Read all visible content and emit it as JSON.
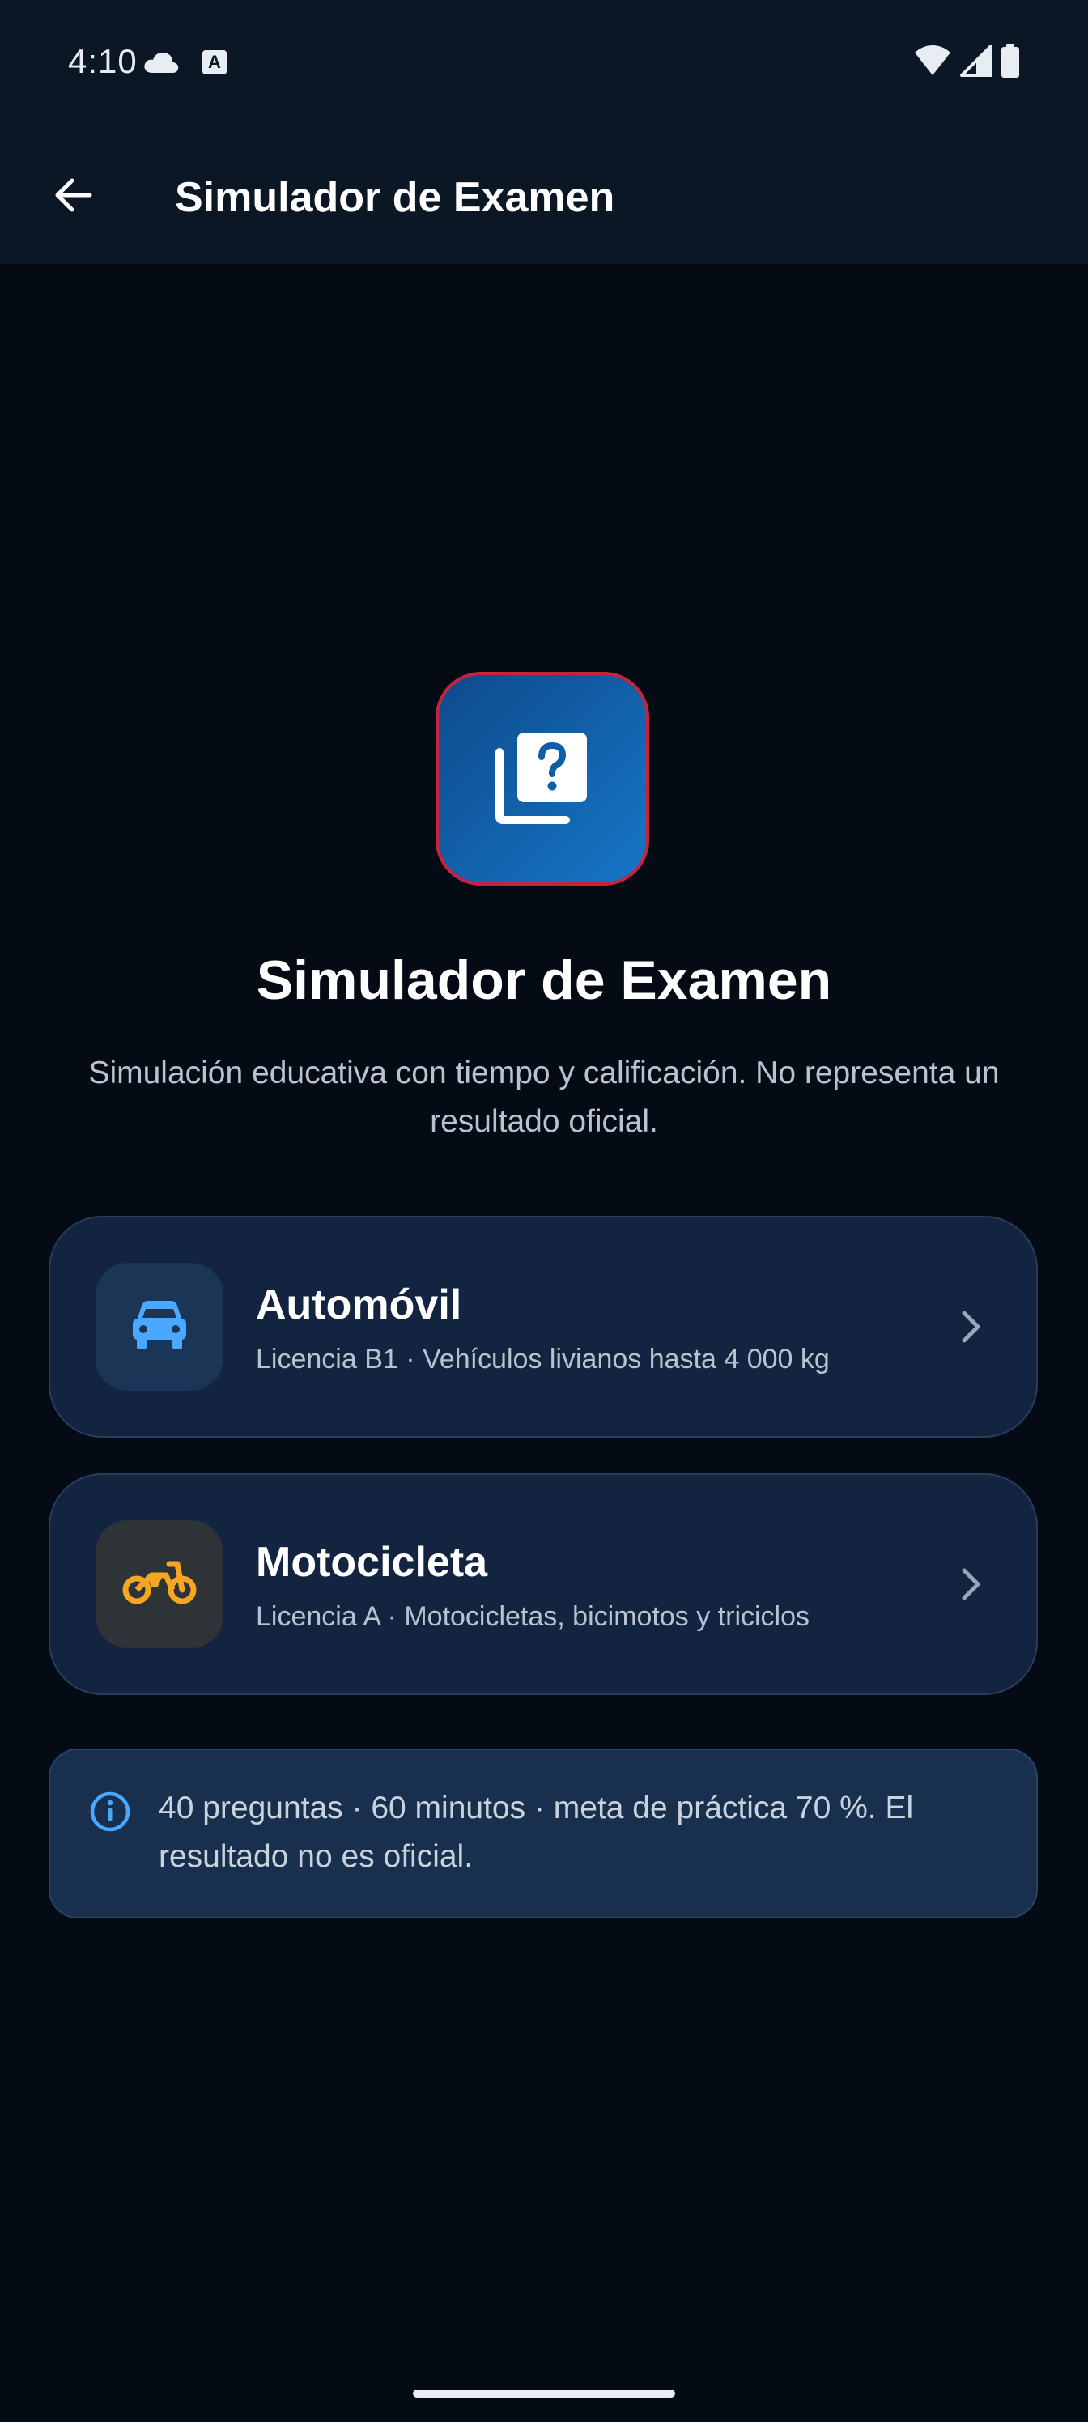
{
  "status_bar": {
    "time": "4:10",
    "icons": [
      "cloud-icon",
      "font-a-icon",
      "wifi-icon",
      "signal-icon",
      "battery-icon"
    ]
  },
  "app_bar": {
    "back_icon": "arrow-back-icon",
    "title": "Simulador de Examen"
  },
  "hero": {
    "icon": "quiz-icon",
    "title": "Simulador de Examen",
    "subtitle": "Simulación educativa con tiempo y calificación. No representa un resultado oficial."
  },
  "options": [
    {
      "icon": "car-icon",
      "title": "Automóvil",
      "description": "Licencia B1 · Vehículos livianos hasta 4 000 kg",
      "accent": "#4aa8ff"
    },
    {
      "icon": "motorcycle-icon",
      "title": "Motocicleta",
      "description": "Licencia A · Motocicletas, bicimotos y triciclos",
      "accent": "#f5a623"
    }
  ],
  "info": {
    "icon": "info-icon",
    "text": "40 preguntas · 60 minutos · meta de práctica 70 %. El resultado no es oficial."
  },
  "colors": {
    "background": "#050b14",
    "app_bar": "#0c1726",
    "card": "#122440",
    "info_box": "#182f4d",
    "hero_border": "#c8233d",
    "hero_fill": "#1676c6"
  }
}
